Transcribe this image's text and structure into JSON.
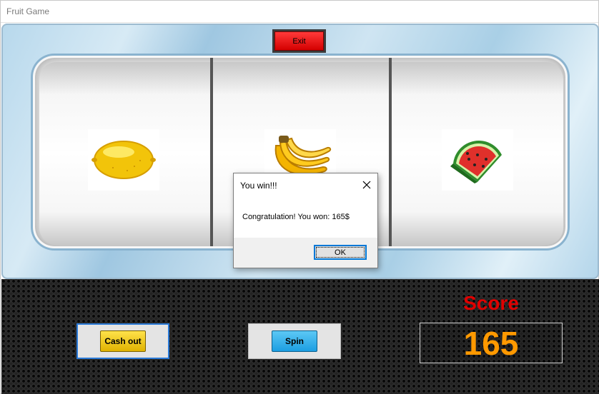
{
  "window": {
    "title": "Fruit Game"
  },
  "machine": {
    "exit_label": "Exit",
    "reels": [
      {
        "symbol": "lemon-icon"
      },
      {
        "symbol": "banana-icon"
      },
      {
        "symbol": "watermelon-icon"
      }
    ]
  },
  "controls": {
    "cashout_label": "Cash out",
    "spin_label": "Spin"
  },
  "score": {
    "label": "Score",
    "value": "165"
  },
  "dialog": {
    "title": "You win!!!",
    "message": "Congratulation! You won: 165$",
    "ok_label": "OK"
  },
  "colors": {
    "exit": "#e00000",
    "cashout": "#ffd21a",
    "spin": "#2fb0ee",
    "score_label": "#e00000",
    "score_value": "#ff9900",
    "dialog_focus": "#0078d7"
  }
}
